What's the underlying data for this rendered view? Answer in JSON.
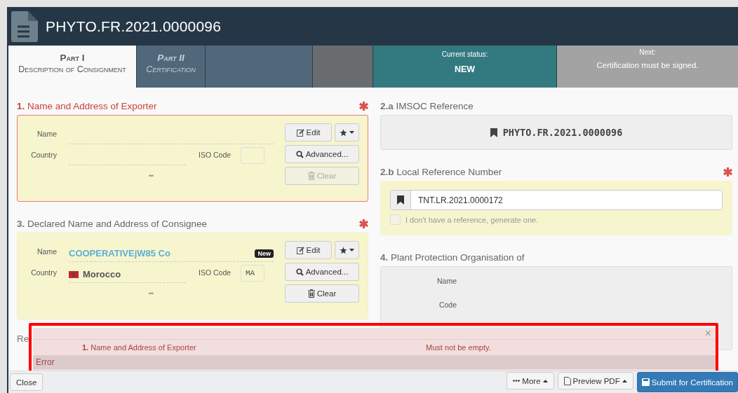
{
  "document": {
    "title": "PHYTO.FR.2021.0000096"
  },
  "tabs": [
    {
      "title": "Part I",
      "subtitle": "Description of Consignment",
      "selected": true
    },
    {
      "title": "Part II",
      "subtitle": "Certification",
      "selected": false
    }
  ],
  "status": {
    "label": "Current status:",
    "value": "NEW"
  },
  "next": {
    "label": "Next:",
    "value": "Certification must be signed."
  },
  "exporter": {
    "number": "1.",
    "title": "Name and Address of Exporter",
    "required": true,
    "invalid": true,
    "name_label": "Name",
    "country_label": "Country",
    "iso_label": "ISO Code",
    "more": "•••",
    "buttons": [
      {
        "kind": "edit",
        "label": "Edit",
        "disabled": false
      },
      {
        "kind": "star",
        "disabled": false
      },
      {
        "kind": "advanced",
        "label": "Advanced...",
        "disabled": false
      },
      {
        "kind": "clear",
        "label": "Clear",
        "disabled": true
      }
    ]
  },
  "consignee": {
    "number": "3.",
    "title": "Declared Name and Address of Consignee",
    "required": true,
    "invalid": false,
    "name_label": "Name",
    "name": "COOPERATIVEjW85 Co",
    "badge": "New",
    "country_label": "Country",
    "country": "Morocco",
    "iso_label": "ISO Code",
    "iso": "MA",
    "more": "•••",
    "buttons": [
      {
        "kind": "edit",
        "label": "Edit",
        "disabled": false
      },
      {
        "kind": "star",
        "disabled": false
      },
      {
        "kind": "advanced",
        "label": "Advanced...",
        "disabled": false
      },
      {
        "kind": "clear",
        "label": "Clear",
        "disabled": false
      }
    ]
  },
  "imsoc": {
    "number": "2.a",
    "title": "IMSOC Reference",
    "value": "PHYTO.FR.2021.0000096"
  },
  "local_reference": {
    "number": "2.b",
    "title": "Local Reference Number",
    "required": true,
    "value": "TNT.LR.2021.0000172",
    "generate_label": "I don't have a reference, generate one.",
    "generate_checked": false
  },
  "ppo": {
    "number": "4.",
    "title": "Plant Protection Organisation of",
    "fields": [
      "Name",
      "Code"
    ]
  },
  "hidden_section": {
    "title": "Re"
  },
  "errors": {
    "close": "×",
    "rows": [
      {
        "number": "1.",
        "field": "Name and Address of Exporter",
        "message": "Must not be empty."
      }
    ],
    "footer": "Error"
  },
  "footer": {
    "close": "Close",
    "buttons": [
      {
        "kind": "more",
        "label": "More"
      },
      {
        "kind": "pdf",
        "label": "Preview PDF"
      },
      {
        "kind": "submit",
        "label": "Submit for Certification"
      }
    ]
  }
}
